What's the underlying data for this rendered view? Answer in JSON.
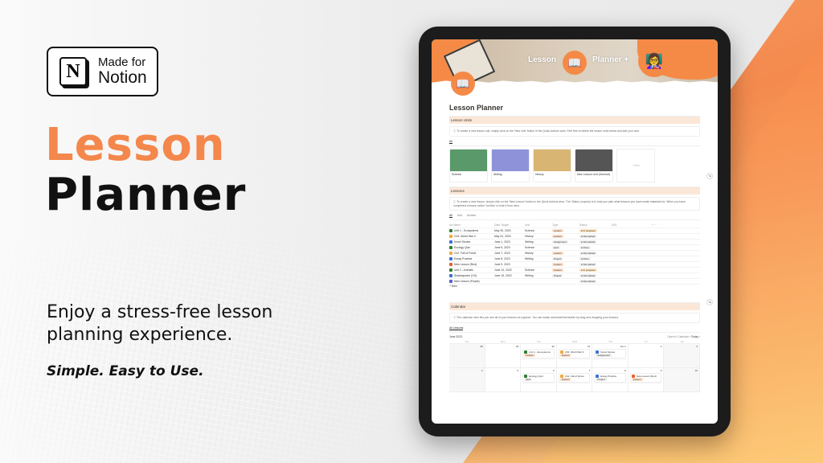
{
  "badge": {
    "small": "Made for",
    "big": "Notion",
    "logo_letter": "N"
  },
  "hero": {
    "title_line1": "Lesson",
    "title_line2": "Planner",
    "tagline": "Enjoy a stress-free lesson planning experience.",
    "subtagline": "Simple. Easy to Use."
  },
  "colors": {
    "accent": "#f4874b",
    "dark": "#111111",
    "section_bg": "#fbe7d8"
  },
  "notion": {
    "cover": {
      "word1": "Lesson",
      "word2": "Planner +",
      "book_icon": "📖",
      "avatar_icon": "👩‍🏫"
    },
    "page_icon": "📖",
    "page_title": "Lesson Planner",
    "units": {
      "heading": "Lesson Units",
      "callout": "To create a new lesson unit, simply click on the 'New Unit' button in the Quick Actions area. Feel free to delete the lesson units below and add your own.",
      "tab": "All",
      "cards": [
        {
          "label": "Science",
          "color": "#5a9a6a"
        },
        {
          "label": "Writing",
          "color": "#8e93d9"
        },
        {
          "label": "History",
          "color": "#d9b574"
        },
        {
          "label": "New Lesson Unit (General)",
          "color": "#555555"
        }
      ],
      "new_label": "+ New"
    },
    "lessons": {
      "heading": "Lessons",
      "callout": "To create a new lesson, simply click on the 'New Lesson' button in the Quick Actions area. The 'Status' property is to help you plan what lessons you have made materials for. When you have completed a lesson select 'Archive' to hide it from view.",
      "tabs": [
        "All",
        "Unit",
        "Archive"
      ],
      "columns": [
        "Aa Name",
        "Date Taught",
        "Unit",
        "Type",
        "Status",
        "URL"
      ],
      "rows": [
        {
          "name": "Unit 1 - Ecosystems",
          "date": "May 30, 2023",
          "unit": "Science",
          "type": "Lesson",
          "status": "In progress",
          "color": "#2e7d32"
        },
        {
          "name": "Ch5. World War II",
          "date": "May 31, 2023",
          "unit": "History",
          "type": "Lesson",
          "status": "Not started",
          "color": "#f0a93b"
        },
        {
          "name": "Novel Stories",
          "date": "June 1, 2023",
          "unit": "Writing",
          "type": "Assignment",
          "status": "Not started",
          "color": "#3b6fd9"
        },
        {
          "name": "Ecology Quiz",
          "date": "June 6, 2023",
          "unit": "Science",
          "type": "Quiz",
          "status": "Done",
          "color": "#2e7d32"
        },
        {
          "name": "Ch2. Fall of Rome",
          "date": "June 7, 2023",
          "unit": "History",
          "type": "Lesson",
          "status": "Not started",
          "color": "#f0a93b"
        },
        {
          "name": "Essay Practice",
          "date": "June 8, 2023",
          "unit": "Writing",
          "type": "Project",
          "status": "Done",
          "color": "#3b6fd9"
        },
        {
          "name": "New Lesson (Red)",
          "date": "June 9, 2023",
          "unit": "",
          "type": "Lesson",
          "status": "Not started",
          "color": "#e8602c"
        },
        {
          "name": "Unit 2 - Animals",
          "date": "June 13, 2023",
          "unit": "Science",
          "type": "Lesson",
          "status": "In progress",
          "color": "#2e7d32"
        },
        {
          "name": "Shakespeare (1/3)",
          "date": "June 15, 2023",
          "unit": "Writing",
          "type": "Project",
          "status": "Not started",
          "color": "#3b6fd9"
        },
        {
          "name": "New Lesson (Purple)",
          "date": "",
          "unit": "",
          "type": "",
          "status": "Not started",
          "color": "#5b5bd6"
        }
      ],
      "new_label": "+ New"
    },
    "calendar": {
      "heading": "Calendar",
      "callout": "The calendar view lets you see all of your lessons at a glance. You can easily schedule/reschedule by drag and dropping your lessons.",
      "tab": "All Lessons",
      "month": "June 2023",
      "open_label": "Open in Calendar",
      "today_label": "Today",
      "days": [
        "Sun",
        "Mon",
        "Tue",
        "Wed",
        "Thu",
        "Fri",
        "Sat"
      ],
      "weeks": [
        [
          {
            "day": "28",
            "dim": true
          },
          {
            "day": "29"
          },
          {
            "day": "30",
            "event": {
              "name": "Unit 1 - Ecosystems",
              "tag": "Lesson",
              "color": "#2e7d32"
            }
          },
          {
            "day": "31",
            "event": {
              "name": "Ch5. World War II",
              "tag": "Lesson",
              "color": "#f0a93b"
            }
          },
          {
            "day": "Jun 1",
            "event": {
              "name": "Novel Stories",
              "tag": "Assignment",
              "color": "#3b6fd9"
            }
          },
          {
            "day": "2"
          },
          {
            "day": "3",
            "dim": true
          }
        ],
        [
          {
            "day": "4",
            "dim": true
          },
          {
            "day": "5"
          },
          {
            "day": "6",
            "event": {
              "name": "Ecology Quiz",
              "tag": "Quiz",
              "color": "#2e7d32"
            }
          },
          {
            "day": "7",
            "event": {
              "name": "Ch2. Fall of Rome",
              "tag": "Lesson",
              "color": "#f0a93b"
            }
          },
          {
            "day": "8",
            "event": {
              "name": "Essay Practice",
              "tag": "Project",
              "color": "#3b6fd9"
            }
          },
          {
            "day": "9",
            "event": {
              "name": "New Lesson (Red)",
              "tag": "Lesson",
              "color": "#e8602c"
            }
          },
          {
            "day": "10",
            "dim": true
          }
        ]
      ]
    }
  }
}
